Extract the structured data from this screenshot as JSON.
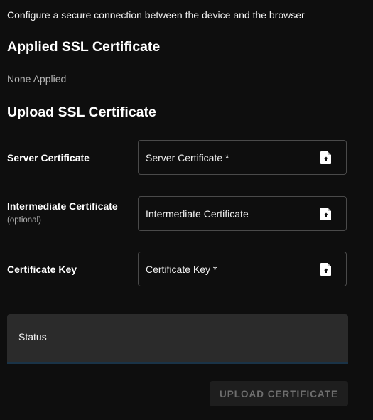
{
  "intro": "Configure a secure connection between the device and the browser",
  "applied": {
    "heading": "Applied SSL Certificate",
    "value": "None Applied"
  },
  "upload": {
    "heading": "Upload SSL Certificate",
    "rows": [
      {
        "label": "Server Certificate",
        "sublabel": "",
        "field_text": "Server Certificate *",
        "icon": "file-upload-icon"
      },
      {
        "label": "Intermediate Certificate",
        "sublabel": "(optional)",
        "field_text": "Intermediate Certificate",
        "icon": "file-upload-icon"
      },
      {
        "label": "Certificate Key",
        "sublabel": "",
        "field_text": "Certificate Key *",
        "icon": "file-upload-icon"
      }
    ]
  },
  "status": {
    "label": "Status"
  },
  "button": {
    "upload_label": "UPLOAD CERTIFICATE",
    "disabled": true
  },
  "colors": {
    "background": "#0e0e0e",
    "card": "#2b2b2b",
    "accent_bar": "#1a3347",
    "button_bg": "#1e1e1e",
    "button_text_disabled": "#6e6e6e"
  }
}
